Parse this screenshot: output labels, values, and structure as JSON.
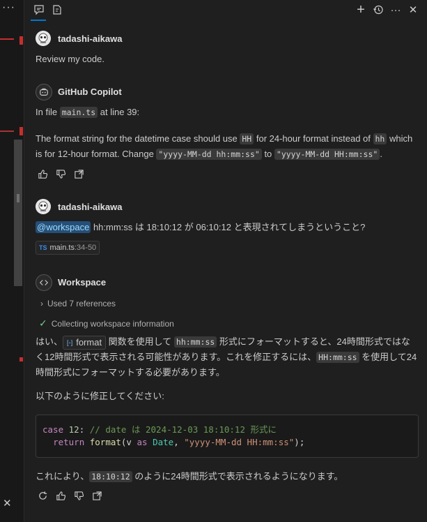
{
  "left_panel": {
    "more_label": "···",
    "close_label": "✕"
  },
  "header": {
    "new_chat_tooltip": "+",
    "more_label": "···",
    "close_label": "✕"
  },
  "messages": {
    "m1": {
      "author": "tadashi-aikawa",
      "text": "Review my code."
    },
    "m2": {
      "author": "GitHub Copilot",
      "line1_pre": "In file ",
      "line1_code": "main.ts",
      "line1_post": " at line 39:",
      "p_a": "The format string for the datetime case should use ",
      "p_code1": "HH",
      "p_b": " for 24-hour format instead of ",
      "p_code2": "hh",
      "p_c": " which",
      "p2_a": "is for 12-hour format. Change ",
      "p2_code1": "\"yyyy-MM-dd hh:mm:ss\"",
      "p2_b": " to ",
      "p2_code2": "\"yyyy-MM-dd HH:mm:ss\"",
      "p2_c": "."
    },
    "m3": {
      "author": "tadashi-aikawa",
      "mention": "@workspace",
      "text": " hh:mm:ss は 18:10:12 が 06:10:12 と表現されてしまうということ?",
      "ref_badge": "TS",
      "ref_file": "main.ts",
      "ref_range": ":34-50"
    },
    "m4": {
      "author": "Workspace",
      "used_refs": "Used 7 references",
      "collecting": "Collecting workspace information",
      "l1_a": "はい、",
      "l1_chip": "format",
      "l1_b": " 関数を使用して ",
      "l1_code": "hh:mm:ss",
      "l1_c": " 形式にフォーマットすると、24時間形式ではな",
      "l2_a": "く12時間形式で表示される可能性があります。これを修正するには、",
      "l2_code": "HH:mm:ss",
      "l2_b": " を使用して24",
      "l3": "時間形式にフォーマットする必要があります。",
      "l4": "以下のように修正してください:",
      "code_l1_kw": "case",
      "code_l1_num": "12",
      "code_l1_colon": ":",
      "code_l1_comment": "// date は 2024-12-03 18:10:12 形式に",
      "code_l2_kw": "return",
      "code_l2_fn": "format",
      "code_l2_open": "(v ",
      "code_l2_as": "as",
      "code_l2_type": "Date",
      "code_l2_comma": ", ",
      "code_l2_str": "\"yyyy-MM-dd HH:mm:ss\"",
      "code_l2_close": ");",
      "l5_a": "これにより、",
      "l5_code": "18:10:12",
      "l5_b": " のように24時間形式で表示されるようになります。"
    }
  },
  "colors": {
    "accent": "#0078d4",
    "check": "#73c991",
    "mention_bg": "#264f78"
  }
}
